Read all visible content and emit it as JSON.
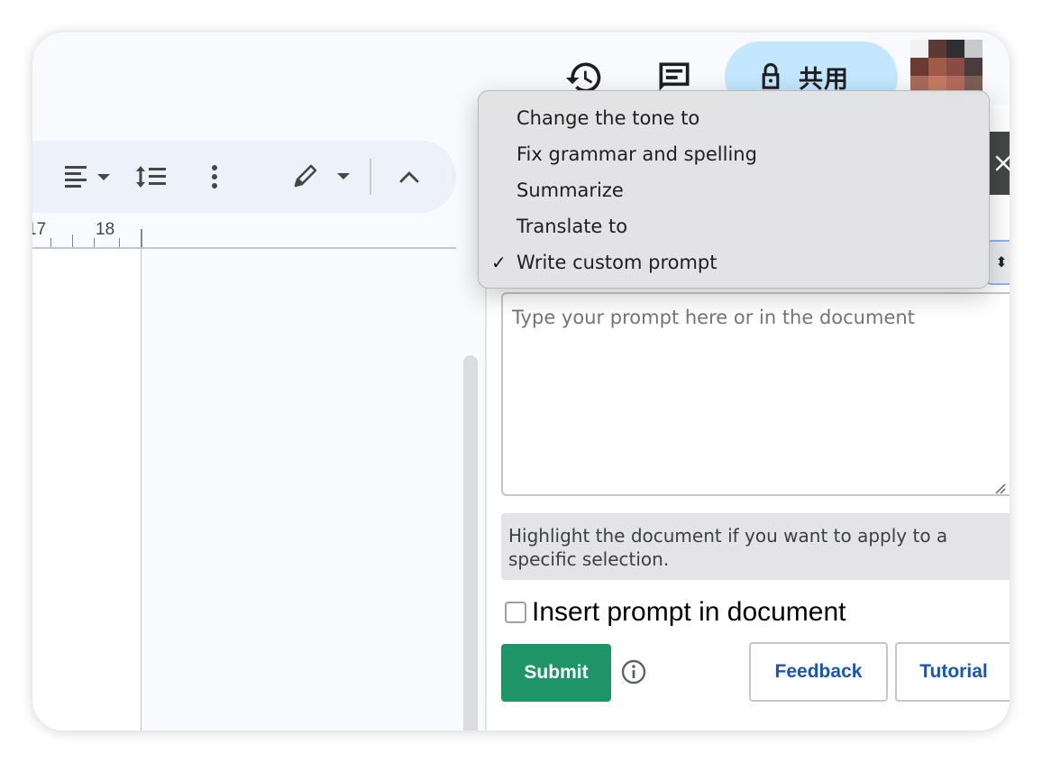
{
  "topbar": {
    "share_label": "共用"
  },
  "ruler": {
    "numbers": [
      "17",
      "18"
    ]
  },
  "menu": {
    "items": [
      "Change the tone to",
      "Fix grammar and spelling",
      "Summarize",
      "Translate to",
      "Write custom prompt"
    ],
    "selected_item": "Write custom prompt"
  },
  "panel": {
    "prompt_placeholder": "Type your prompt here or in the document",
    "hint": "Highlight the document if you want to apply to a specific selection.",
    "insert_checkbox_label": "Insert prompt in document",
    "submit_label": "Submit",
    "feedback_label": "Feedback",
    "tutorial_label": "Tutorial"
  },
  "colors": {
    "share_bg": "#c2e7ff",
    "submit_bg": "#1e9468",
    "link_text": "#1a56b0"
  }
}
